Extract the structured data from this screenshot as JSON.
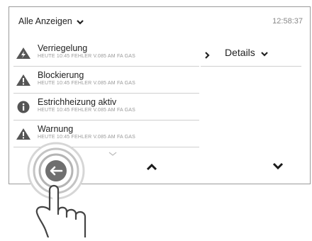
{
  "header": {
    "filter_label": "Alle Anzeigen",
    "time": "12:58:37"
  },
  "messages": [
    {
      "icon": "warning-bolt-icon",
      "title": "Verriegelung",
      "sub": "HEUTE 10:45 FEHLER V.085 AM FA GAS"
    },
    {
      "icon": "warning-icon",
      "title": "Blockierung",
      "sub": "HEUTE 10:45 FEHLER V.085 AM FA GAS"
    },
    {
      "icon": "info-icon",
      "title": "Estrichheizung aktiv",
      "sub": "HEUTE 10:45 FEHLER V.085 AM FA GAS"
    },
    {
      "icon": "warning-icon",
      "title": "Warnung",
      "sub": "HEUTE 10:45 FEHLER V.085 AM FA GAS"
    }
  ],
  "detail": {
    "label": "Details"
  },
  "nav": {
    "back": "back-icon",
    "up": "chevron-up-icon",
    "down": "chevron-down-icon"
  },
  "colors": {
    "icon_dark": "#555555",
    "divider": "#cfcfcf",
    "ring": "#9b9b9b"
  }
}
